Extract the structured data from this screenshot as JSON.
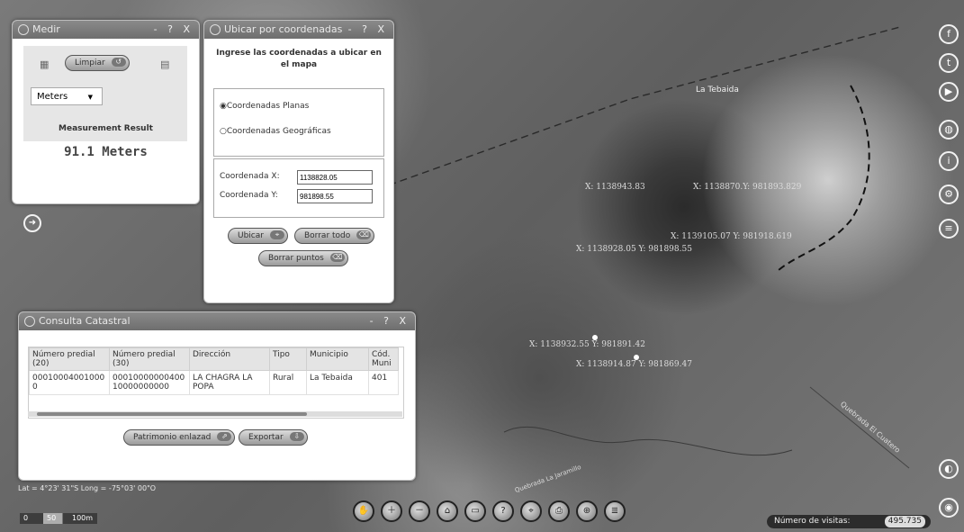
{
  "medir": {
    "title": "Medir",
    "controls": "- ? X",
    "clear_label": "Limpiar",
    "units_value": "Meters",
    "result_label": "Measurement Result",
    "result_value": "91.1 Meters"
  },
  "ubicar": {
    "title": "Ubicar por coordenadas",
    "controls": "- ? X",
    "heading": "Ingrese las coordenadas a ubicar en el mapa",
    "option_planas": "Coordenadas Planas",
    "option_geograficas": "Coordenadas Geográficas",
    "label_x": "Coordenada X:",
    "value_x": "1138828.05",
    "label_y": "Coordenada Y:",
    "value_y": "981898.55",
    "btn_ubicar": "Ubicar",
    "btn_borrar_todo": "Borrar todo",
    "btn_borrar_puntos": "Borrar puntos"
  },
  "catastral": {
    "title": "Consulta Catastral",
    "controls": "- ? X",
    "columns": [
      "Número predial (20)",
      "Número predial (30)",
      "Dirección",
      "Tipo",
      "Municipio",
      "Cód. Muni"
    ],
    "rows": [
      [
        "00010004001000 0",
        "00010000000400 10000000000",
        "LA CHAGRA LA POPA",
        "Rural",
        "La Tebaida",
        "401"
      ]
    ],
    "btn_patrimonio": "Patrimonio enlazad",
    "btn_exportar": "Exportar"
  },
  "map": {
    "place_label": "La Tebaida",
    "river_label": "Quebrada El Cuatero",
    "bottom_label": "Quebrada La Jaramillo",
    "coord_labels": [
      "X: 1138943.83",
      "X: 1138870.Y: 981893.829",
      "X: 1139105.07 Y: 981918.619",
      "X: 1138928.05 Y: 981898.55",
      "X: 1138932.55 Y: 981891.42",
      "X: 1138914.87 Y: 981869.47"
    ]
  },
  "status": {
    "latlong": "Lat = 4°23' 31\"S Long = -75°03' 00\"O",
    "scale_0": "0",
    "scale_50": "50",
    "scale_100": "100m",
    "visits_label": "Número de visitas:",
    "visits_value": "495.735"
  },
  "social": [
    "facebook-icon",
    "twitter-icon",
    "youtube-icon",
    "globe-icon",
    "info-icon",
    "settings-icon",
    "layers-icon"
  ]
}
